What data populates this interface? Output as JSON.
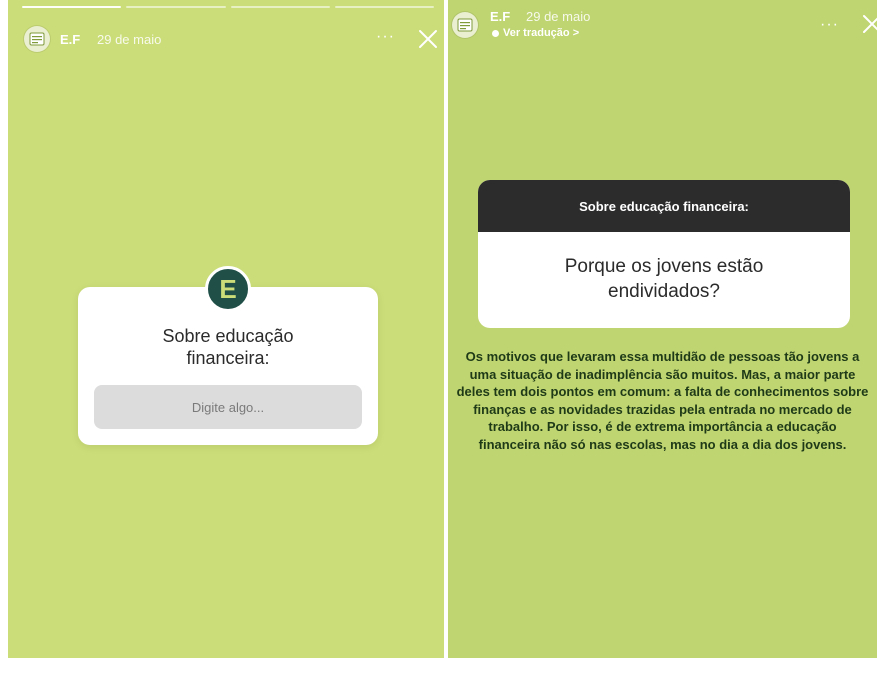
{
  "left_story": {
    "username": "E.F",
    "date": "29 de maio",
    "more": "···",
    "question_box": {
      "badge_letter": "E",
      "title": "Sobre educação financeira:",
      "input_placeholder": "Digite algo..."
    }
  },
  "right_story": {
    "username": "E.F",
    "date": "29 de maio",
    "translate_label": "Ver tradução >",
    "more": "···",
    "question_card": {
      "header": "Sobre educação financeira:",
      "question": "Porque os jovens estão endividados?"
    },
    "answer": "Os motivos que levaram essa multidão de pessoas tão jovens a uma situação de inadimplência são muitos. Mas, a maior parte deles tem dois pontos em comum: a falta de conhecimentos sobre finanças e as novidades trazidas pela entrada no mercado de trabalho. Por isso, é de extrema importância a educação financeira não só nas escolas, mas no dia a dia dos jovens."
  },
  "colors": {
    "left_background": "#cbdd78",
    "right_background": "#bfd571",
    "badge": "#1f4f47",
    "card_header": "#2c2c2c"
  }
}
